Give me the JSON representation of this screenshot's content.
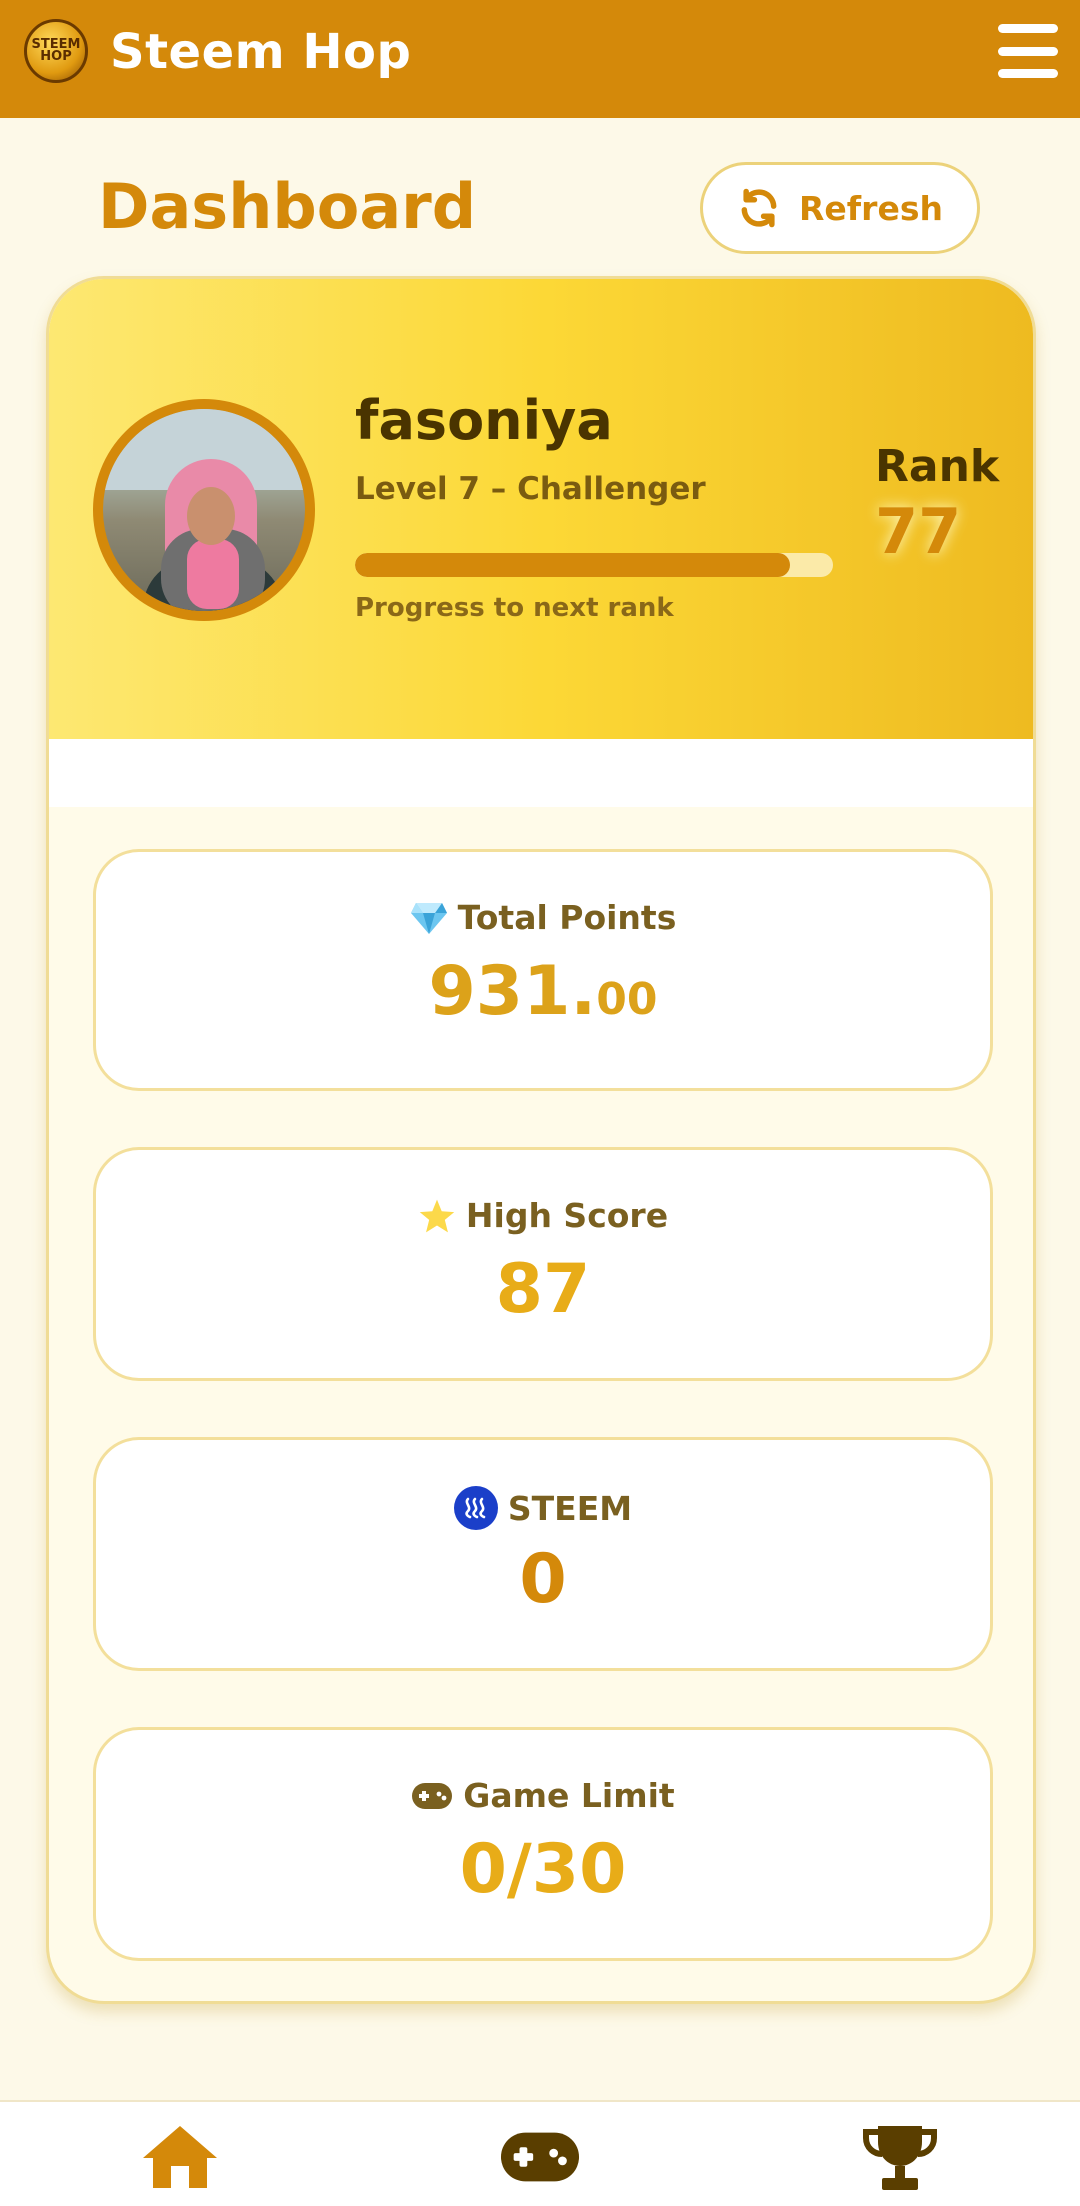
{
  "header": {
    "app_title": "Steem Hop",
    "logo_text": "STEEM HOP",
    "menu_icon": "hamburger-menu-icon"
  },
  "title_row": {
    "page_title": "Dashboard",
    "refresh_label": "Refresh",
    "refresh_icon": "refresh-icon"
  },
  "profile": {
    "username": "fasoniya",
    "level": "Level 7 – Challenger",
    "progress_fraction": 0.91,
    "progress_label": "Progress to next rank",
    "rank_label": "Rank",
    "rank_value": "77"
  },
  "stats": [
    {
      "icon": "gem-icon",
      "label": "Total Points",
      "value_int": "931.",
      "value_dec": "00",
      "color": "#dca21a"
    },
    {
      "icon": "star-icon",
      "label": "High Score",
      "value_int": "87",
      "value_dec": "",
      "color": "#e8ac18"
    },
    {
      "icon": "steem-icon",
      "label": "STEEM",
      "value_int": "0",
      "value_dec": "",
      "color": "#d4890a"
    },
    {
      "icon": "gamepad-icon",
      "label": "Game Limit",
      "value_int": "0/30",
      "value_dec": "",
      "color": "#e8ac18"
    }
  ],
  "colors": {
    "brand": "#d4890a",
    "background": "#fdf9e8",
    "nav_active": "#d4890a",
    "nav_inactive": "#5a3e00"
  },
  "bottom_nav": [
    {
      "icon": "home-icon",
      "active": true
    },
    {
      "icon": "gamepad-icon",
      "active": false
    },
    {
      "icon": "trophy-icon",
      "active": false
    }
  ]
}
